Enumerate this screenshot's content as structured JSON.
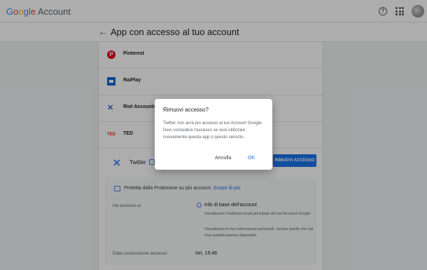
{
  "topbar": {
    "logo_google": [
      "G",
      "o",
      "o",
      "g",
      "l",
      "e"
    ],
    "logo_account": "Account",
    "help_label": "?"
  },
  "subheader": {
    "back_icon": "←",
    "title": "App con accesso al tuo account"
  },
  "apps": [
    {
      "name": "Pinterest",
      "icon": "pinterest-icon",
      "glyph": "P"
    },
    {
      "name": "RaiPlay",
      "icon": "raiplay-icon",
      "glyph": ""
    },
    {
      "name": "Riot Accounts",
      "icon": "riot-icon",
      "glyph": "✕"
    },
    {
      "name": "TED",
      "icon": "ted-icon",
      "glyph": "TED"
    }
  ],
  "selected_app": {
    "name": "Twitter",
    "icon_glyph": "✕",
    "remove_label": "RIMUOVI ACCESSO",
    "protection_text": "Protetta dalla Protezione su più account.",
    "protection_link": "Scopri di più",
    "access_label": "Ha accesso a:",
    "access_title": "Info di base dell'account",
    "access_desc1": "Visualizzare l'indirizzo email principale del tuo Account Google",
    "access_desc2": "Visualizzare le tue informazioni personali, incluse quelle che hai reso pubblicamente disponibili",
    "date_label": "Data concessione accesso:",
    "date_value": "Ieri, 15:46"
  },
  "dialog": {
    "title": "Rimuovi accesso?",
    "body": "Twitter non avrà più accesso al tuo Account Google. Devi concedere l'accesso se vuoi utilizzare nuovamente questa app o questo servizio.",
    "cancel_label": "Annulla",
    "ok_label": "OK"
  },
  "colors": {
    "accent": "#1a73e8",
    "overlay": "rgba(0,0,0,0.32)"
  }
}
